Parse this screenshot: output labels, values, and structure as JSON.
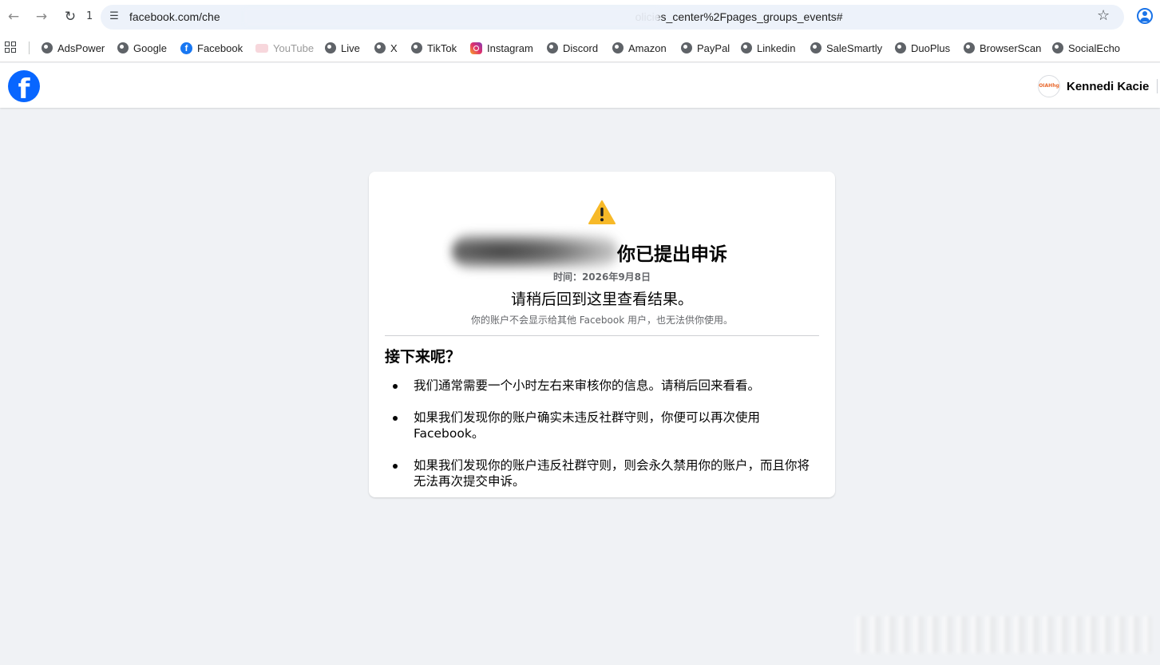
{
  "browser": {
    "tab_count": "1",
    "url": "facebook.com/che",
    "url_tail": "olicies_center%2Fpages_groups_events#"
  },
  "bookmarks": [
    {
      "label": "AdsPower",
      "icon": "globe-icon"
    },
    {
      "label": "Google",
      "icon": "globe-icon"
    },
    {
      "label": "Facebook",
      "icon": "facebook-icon"
    },
    {
      "label": "YouTube",
      "icon": "youtube-icon"
    },
    {
      "label": "Live",
      "icon": "globe-icon"
    },
    {
      "label": "X",
      "icon": "globe-icon"
    },
    {
      "label": "TikTok",
      "icon": "globe-icon"
    },
    {
      "label": "Instagram",
      "icon": "instagram-icon"
    },
    {
      "label": "Discord",
      "icon": "globe-icon"
    },
    {
      "label": "Amazon",
      "icon": "globe-icon"
    },
    {
      "label": "PayPal",
      "icon": "globe-icon"
    },
    {
      "label": "Linkedin",
      "icon": "globe-icon"
    },
    {
      "label": "SaleSmartly",
      "icon": "globe-icon"
    },
    {
      "label": "DuoPlus",
      "icon": "globe-icon"
    },
    {
      "label": "BrowserScan",
      "icon": "globe-icon"
    },
    {
      "label": "SocialEcho",
      "icon": "globe-icon"
    }
  ],
  "header": {
    "logo_letter": "f",
    "user_avatar_text": "OIAHhg",
    "user_name": "Kennedi Kacie"
  },
  "card": {
    "title": "你已提出申诉",
    "time": "时间：2026年9月8日",
    "subtitle": "请稍后回到这里查看结果。",
    "note": "你的账户不会显示给其他 Facebook 用户，也无法供你使用。",
    "section_heading": "接下来呢？",
    "steps": [
      "我们通常需要一个小时左右来审核你的信息。请稍后回来看看。",
      "如果我们发现你的账户确实未违反社群守则，你便可以再次使用 Facebook。",
      "如果我们发现你的账户违反社群守则，则会永久禁用你的账户，而且你将无法再次提交申诉。"
    ]
  },
  "colors": {
    "facebook_blue": "#0866ff",
    "warning_yellow": "#f7b928",
    "page_background": "#f0f2f5"
  }
}
